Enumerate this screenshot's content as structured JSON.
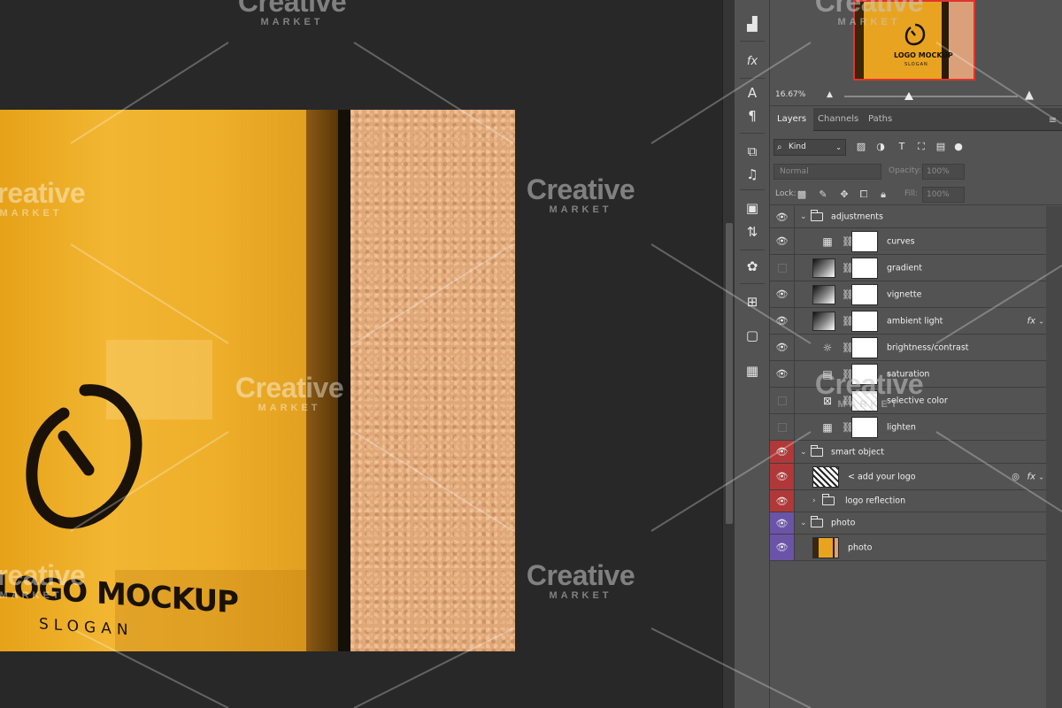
{
  "watermark": {
    "line1": "Creative",
    "line2": "MARKET"
  },
  "document": {
    "logo_text": "LOGO MOCKUP",
    "slogan": "SLOGAN"
  },
  "navigator": {
    "zoom": "16.67%",
    "thumb_text": "LOGO MOCKUP",
    "thumb_slogan": "SLOGAN"
  },
  "tabs": [
    {
      "label": "Layers",
      "active": true
    },
    {
      "label": "Channels",
      "active": false
    },
    {
      "label": "Paths",
      "active": false
    }
  ],
  "filter": {
    "kind_label": "Kind"
  },
  "blend": {
    "mode": "Normal",
    "opacity_label": "Opacity:",
    "opacity_value": "100%"
  },
  "lock": {
    "label": "Lock:",
    "fill_label": "Fill:",
    "fill_value": "100%"
  },
  "layers": [
    {
      "name": "adjustments",
      "kind": "group",
      "visible": true,
      "color": "none",
      "indent": 0
    },
    {
      "name": "curves",
      "kind": "curves",
      "visible": true,
      "color": "none",
      "indent": 1
    },
    {
      "name": "gradient",
      "kind": "gradient",
      "visible": false,
      "color": "none",
      "indent": 1
    },
    {
      "name": "vignette",
      "kind": "gradient",
      "visible": true,
      "color": "none",
      "indent": 1
    },
    {
      "name": "ambient light",
      "kind": "gradient",
      "visible": true,
      "color": "none",
      "indent": 1,
      "fx": true
    },
    {
      "name": "brightness/contrast",
      "kind": "brightness",
      "visible": true,
      "color": "none",
      "indent": 1
    },
    {
      "name": "saturation",
      "kind": "saturation",
      "visible": true,
      "color": "none",
      "indent": 1
    },
    {
      "name": "selective color",
      "kind": "selective",
      "visible": false,
      "color": "none",
      "indent": 1
    },
    {
      "name": "lighten",
      "kind": "curves",
      "visible": false,
      "color": "none",
      "indent": 1
    },
    {
      "name": "smart object",
      "kind": "group",
      "visible": true,
      "color": "red",
      "indent": 0
    },
    {
      "name": "< add your logo",
      "kind": "smart",
      "visible": true,
      "color": "red",
      "indent": 1,
      "fx": true
    },
    {
      "name": "logo reflection",
      "kind": "subgroup",
      "visible": true,
      "color": "red",
      "indent": 1
    },
    {
      "name": "photo",
      "kind": "group",
      "visible": true,
      "color": "violet",
      "indent": 0
    },
    {
      "name": "photo",
      "kind": "photo",
      "visible": true,
      "color": "violet",
      "indent": 1
    }
  ],
  "colors": {
    "label_red": "#b03838",
    "label_violet": "#6b54a8",
    "navigator_border": "#e0342c",
    "panel_bg": "#535353",
    "canvas_bg": "#282828"
  },
  "icons": {
    "eye": "eye-icon",
    "fx": "fx",
    "tools": [
      "histogram-icon",
      "fx-icon",
      "character-icon",
      "paragraph-icon",
      "clone-source-icon",
      "glyphs-icon",
      "image-icon",
      "history-icon",
      "color-palette-icon",
      "adjustments-icon",
      "swatch-icon",
      "table-icon"
    ]
  }
}
